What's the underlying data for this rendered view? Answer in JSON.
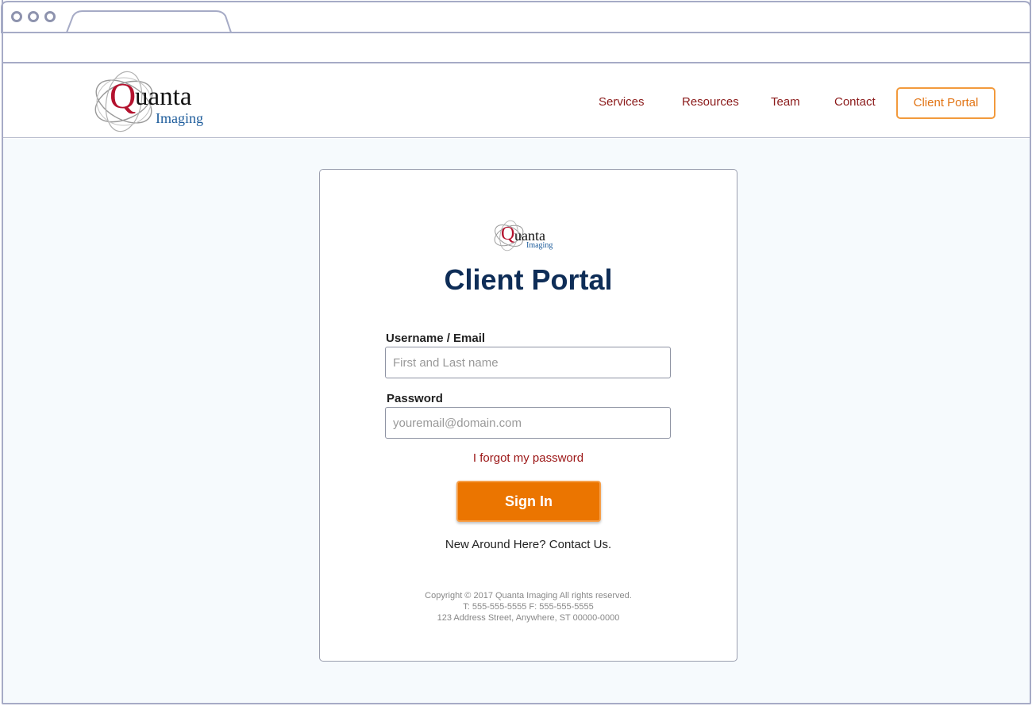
{
  "browser": {
    "tab_label": ""
  },
  "logo": {
    "q": "Q",
    "uanta": "uanta",
    "imaging": "Imaging"
  },
  "nav": {
    "items": [
      {
        "label": "Services"
      },
      {
        "label": "Resources"
      },
      {
        "label": "Team"
      },
      {
        "label": "Contact"
      }
    ],
    "portal_label": "Client Portal"
  },
  "card": {
    "title": "Client Portal",
    "username": {
      "label": "Username / Email",
      "placeholder": "First and Last name",
      "value": ""
    },
    "password": {
      "label": "Password",
      "placeholder": "youremail@domain.com",
      "value": ""
    },
    "forgot_link": "I forgot my password",
    "signin_label": "Sign In",
    "new_here": "New Around Here? Contact Us.",
    "footer": {
      "copyright": "Copyright © 2017 Quanta Imaging All rights reserved.",
      "phone": "T: 555-555-5555 F: 555-555-5555",
      "address": "123 Address Street, Anywhere, ST 00000-0000"
    }
  },
  "colors": {
    "brand_red": "#b4122e",
    "brand_blue": "#1d5c9b",
    "title_navy": "#0e2d57",
    "accent_orange": "#eb7500",
    "nav_red": "#8b1a1a"
  }
}
